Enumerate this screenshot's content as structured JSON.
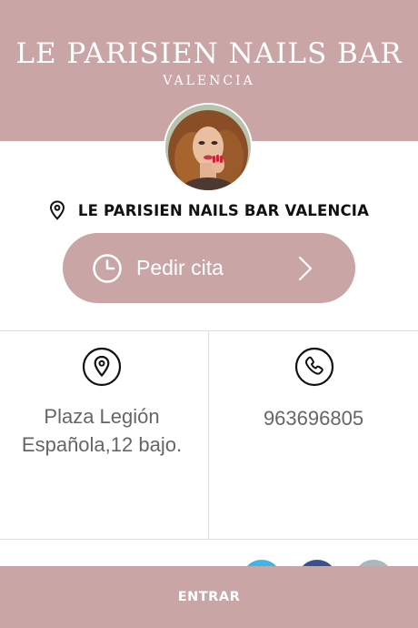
{
  "header": {
    "brand_title": "LE PARISIEN NAILS BAR",
    "brand_subtitle": "VALENCIA"
  },
  "business": {
    "name": "LE PARISIEN NAILS BAR VALENCIA",
    "location_icon": "location-pin-icon",
    "avatar": "avatar"
  },
  "cta": {
    "label": "Pedir cita",
    "icon": "clock-icon",
    "chevron": "chevron-right-icon"
  },
  "info": {
    "address_icon": "location-pin-icon",
    "address": "Plaza Legión Española,12 bajo.",
    "phone_icon": "phone-icon",
    "phone": "963696805"
  },
  "social": {
    "icons": [
      "twitter-icon",
      "facebook-icon",
      "google-plus-icon"
    ],
    "colors": [
      "#3cb6e6",
      "#36528f",
      "#a9b8bf"
    ]
  },
  "footer": {
    "enter_label": "ENTRAR"
  },
  "colors": {
    "brand": "#c9a5a6",
    "text_dark": "#111111",
    "text_muted": "#666666"
  }
}
